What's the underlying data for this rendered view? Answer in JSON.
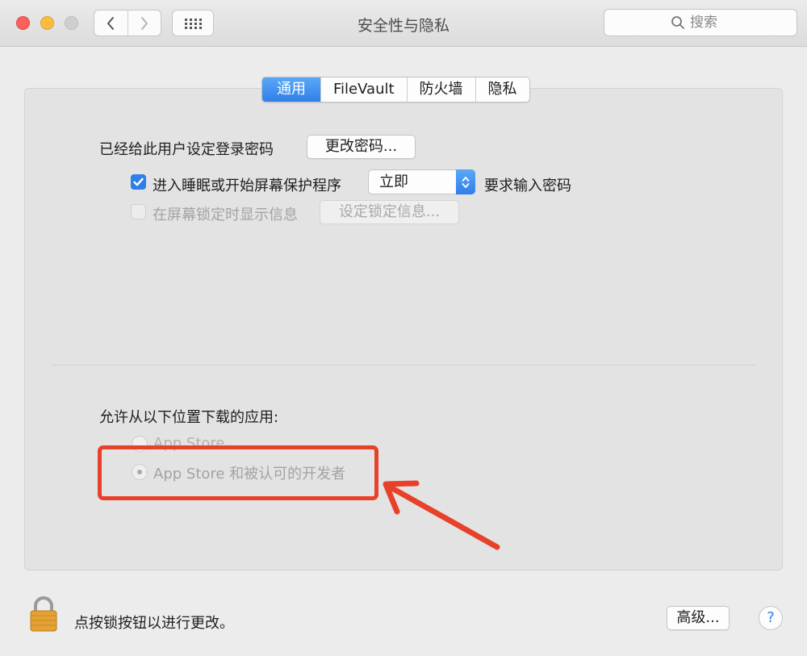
{
  "window": {
    "title": "安全性与隐私",
    "search_placeholder": "搜索"
  },
  "tabs": [
    {
      "label": "通用",
      "active": true
    },
    {
      "label": "FileVault",
      "active": false
    },
    {
      "label": "防火墙",
      "active": false
    },
    {
      "label": "隐私",
      "active": false
    }
  ],
  "general": {
    "password_label": "已经给此用户设定登录密码",
    "change_password_button": "更改密码...",
    "sleep_checkbox": {
      "label": "进入睡眠或开始屏幕保护程序",
      "checked": true
    },
    "sleep_select_value": "立即",
    "require_password_label": "要求输入密码",
    "lock_message_checkbox": {
      "label": "在屏幕锁定时显示信息",
      "checked": false,
      "enabled": false
    },
    "set_lock_message_button": "设定锁定信息..."
  },
  "downloads": {
    "heading": "允许从以下位置下载的应用:",
    "options": [
      {
        "label": "App Store",
        "selected": false
      },
      {
        "label": "App Store 和被认可的开发者",
        "selected": true
      }
    ]
  },
  "footer": {
    "lock_text": "点按锁按钮以进行更改。",
    "advanced_button": "高级...",
    "help_button": "?"
  },
  "colors": {
    "accent": "#2f7fe9",
    "annotation": "#e8412a"
  }
}
